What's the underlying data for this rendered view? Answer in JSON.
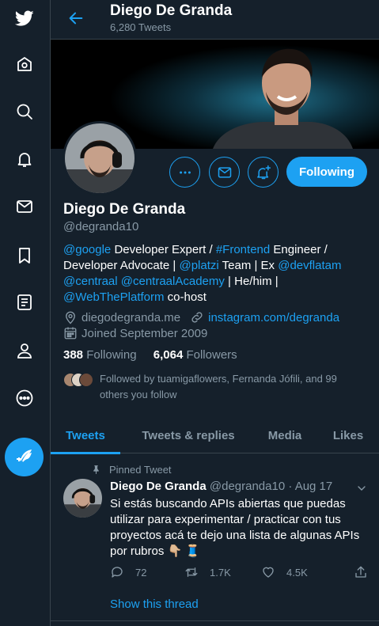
{
  "colors": {
    "bg": "#15202b",
    "accent": "#1da1f2",
    "muted": "#8899a6",
    "border": "#38444d"
  },
  "sidebar": {
    "items": [
      {
        "icon": "twitter-logo-icon"
      },
      {
        "icon": "home-icon"
      },
      {
        "icon": "explore-icon"
      },
      {
        "icon": "notifications-icon"
      },
      {
        "icon": "messages-icon"
      },
      {
        "icon": "bookmarks-icon"
      },
      {
        "icon": "lists-icon"
      },
      {
        "icon": "profile-icon"
      },
      {
        "icon": "more-icon"
      }
    ],
    "compose_icon": "compose-tweet-icon"
  },
  "header": {
    "title": "Diego De Granda",
    "subtitle": "6,280 Tweets"
  },
  "profile": {
    "name": "Diego De Granda",
    "handle": "@degranda10",
    "follow_button": "Following",
    "bio": [
      {
        "t": "@google",
        "link": true
      },
      {
        "t": " Developer Expert / ",
        "link": false
      },
      {
        "t": "#Frontend",
        "link": true
      },
      {
        "t": " Engineer / Developer Advocate | ",
        "link": false
      },
      {
        "t": "@platzi",
        "link": true
      },
      {
        "t": " Team | Ex ",
        "link": false
      },
      {
        "t": "@devflatam",
        "link": true
      },
      {
        "t": " ",
        "link": false
      },
      {
        "t": "@centraal",
        "link": true
      },
      {
        "t": " ",
        "link": false
      },
      {
        "t": "@centraalAcademy",
        "link": true
      },
      {
        "t": " | He/him | ",
        "link": false
      },
      {
        "t": "@WebThePlatform",
        "link": true
      },
      {
        "t": " co-host",
        "link": false
      }
    ],
    "location": "diegodegranda.me",
    "website": "instagram.com/degranda",
    "joined": "Joined September 2009",
    "following_count": "388",
    "following_label": "Following",
    "followers_count": "6,064",
    "followers_label": "Followers",
    "followed_by": "Followed by tuamigaflowers, Fernanda Jófili, and 99 others you follow"
  },
  "tabs": [
    {
      "label": "Tweets",
      "active": true
    },
    {
      "label": "Tweets & replies",
      "active": false
    },
    {
      "label": "Media",
      "active": false
    },
    {
      "label": "Likes",
      "active": false
    }
  ],
  "tweet": {
    "pinned_label": "Pinned Tweet",
    "author": "Diego De Granda",
    "handle": "@degranda10",
    "separator": "·",
    "date": "Aug 17",
    "text": "Si estás buscando APIs abiertas que puedas utilizar para experimentar / practicar con tus proyectos acá te dejo una lista de algunas APIs por rubros 👇🏼 🧵",
    "replies": "72",
    "retweets": "1.7K",
    "likes": "4.5K",
    "show_thread": "Show this thread"
  }
}
